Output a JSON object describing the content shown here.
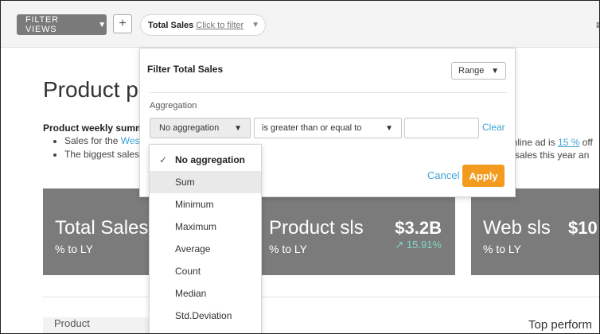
{
  "toolbar": {
    "filter_views_label": "FILTER VIEWS",
    "add_label": "+",
    "filter_pill_name": "Total Sales",
    "filter_pill_link": "Click to filter",
    "menu": "≡"
  },
  "page": {
    "title": "Product p",
    "summary_title": "Product weekly summ",
    "bullets": [
      {
        "text": "Sales for the ",
        "accent": "Wes"
      },
      {
        "text": "The biggest sales",
        "accent": ""
      }
    ],
    "right_line1_pre": "online ad is ",
    "right_line1_accent": "15 %",
    "right_line1_post": " off",
    "right_line2": "n sales this year an"
  },
  "cards": [
    {
      "title": "Total Sales",
      "sub": "% to LY",
      "value": "",
      "delta": ""
    },
    {
      "title": "Product sls",
      "sub": "% to LY",
      "value": "$3.2B",
      "delta": "↗ 15.91%"
    },
    {
      "title": "Web sls",
      "sub": "% to LY",
      "value": "$10",
      "delta": ""
    }
  ],
  "bottom": {
    "product_label": "Product",
    "top_perf": "Top perform"
  },
  "popup": {
    "title": "Filter Total Sales",
    "range_label": "Range",
    "aggregation_label": "Aggregation",
    "aggregation_value": "No aggregation",
    "condition_value": "is greater than or equal to",
    "value_placeholder": "",
    "clear_label": "Clear",
    "cancel_label": "Cancel",
    "apply_label": "Apply"
  },
  "dropdown": {
    "items": [
      "No aggregation",
      "Sum",
      "Minimum",
      "Maximum",
      "Average",
      "Count",
      "Median",
      "Std.Deviation"
    ],
    "selected": "No aggregation",
    "hovered": "Sum",
    "check": "✓"
  },
  "colors": {
    "accent": "#3ea3d5",
    "apply": "#f39b1e",
    "card": "#7b7b7b",
    "delta": "#7fd9c4"
  }
}
